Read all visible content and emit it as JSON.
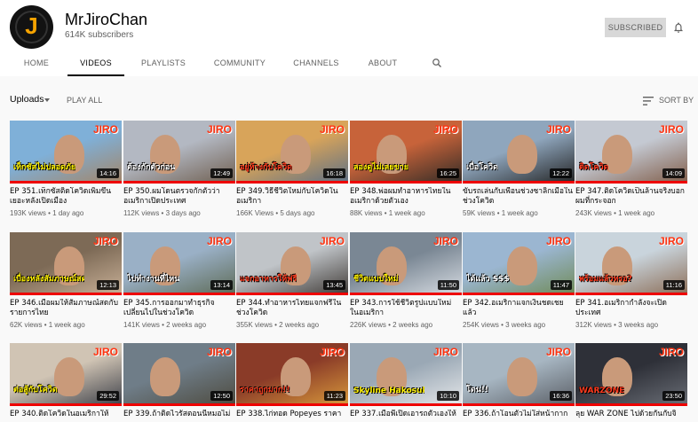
{
  "channel": {
    "avatar_letter": "J",
    "name": "MrJiroChan",
    "subscribers": "614K subscribers",
    "subscribe_label": "SUBSCRIBED"
  },
  "tabs": [
    "HOME",
    "VIDEOS",
    "PLAYLISTS",
    "COMMUNITY",
    "CHANNELS",
    "ABOUT"
  ],
  "active_tab": "VIDEOS",
  "toolbar": {
    "uploads_label": "Uploads",
    "play_all_label": "PLAY ALL",
    "sort_label": "SORT BY"
  },
  "colors": {
    "accent_red": "#ff0000",
    "logo_red": "#ff3311"
  },
  "videos": [
    {
      "title": "EP 351.เท็กซัสติดโควิดเพิ่มขึ้นเยอะหลังเปิดเมือง",
      "views": "193K views",
      "age": "1 day ago",
      "duration": "14:16",
      "thumb_text": "เท็กซัสไม่ปลอดภัย"
    },
    {
      "title": "EP 350.ผมโดนตรวจกักตัวว่าอเมริกาเปิดประเทศ",
      "views": "112K views",
      "age": "3 days ago",
      "duration": "12:49",
      "thumb_text": "ต้องกักตัวก่อน"
    },
    {
      "title": "EP 349.วิธีชีวิตใหม่กับโควิดในอเมริกา",
      "views": "166K Views",
      "age": "5 days ago",
      "duration": "16:18",
      "thumb_text": "อยู่ห้างกับโควิด"
    },
    {
      "title": "EP 348.พ่อผมทำอาหารไทยในอเมริกาด้วยตัวเอง",
      "views": "88K views",
      "age": "1 week ago",
      "duration": "16:25",
      "thumb_text": "ลองดูไม่เลยขาย"
    },
    {
      "title": "ขับรถเล่นกับเพื่อนช่วงซาลิกเมื่อในช่วงโควิด",
      "views": "59K views",
      "age": "1 week ago",
      "duration": "12:22",
      "thumb_text": "เบื่อโควิด"
    },
    {
      "title": "EP 347.ติดโควิดเป็นล้านจริงบอกผมที่กระจอก",
      "views": "243K views",
      "age": "1 week ago",
      "duration": "14:09",
      "thumb_text": "ติดโควิด"
    },
    {
      "title": "EP 346.เมื่อผมให้สัมภาษณ์สดกับรายการไทย",
      "views": "62K views",
      "age": "1 week ago",
      "duration": "12:13",
      "thumb_text": "เบื่องหลังสัมภาษณ์สด"
    },
    {
      "title": "EP 345.การออกมาทำธุรกิจเปลี่ยนไปในช่วงโควิด",
      "views": "141K views",
      "age": "2 weeks ago",
      "duration": "13:14",
      "thumb_text": "ไปทำงานที่ไหน"
    },
    {
      "title": "EP 344.ทำอาหารไทยแจกฟรีในช่วงโควิด",
      "views": "355K views",
      "age": "2 weeks ago",
      "duration": "13:45",
      "thumb_text": "แจกอาหารให้ฟรี"
    },
    {
      "title": "EP 343.การใช้ชีวิตรูปแบบใหม่ในอเมริกา",
      "views": "226K views",
      "age": "2 weeks ago",
      "duration": "11:50",
      "thumb_text": "ชีวิตแบบใหม่"
    },
    {
      "title": "EP 342.อเมริกาแจกเงินชดเชยแล้ว",
      "views": "254K views",
      "age": "3 weeks ago",
      "duration": "11:47",
      "thumb_text": "ได้แล้ว $$$"
    },
    {
      "title": "EP 341.อเมริกากำลังจะเปิดประเทศ",
      "views": "312K views",
      "age": "3 weeks ago",
      "duration": "11:16",
      "thumb_text": "พร้อมแล้วหรอ?"
    },
    {
      "title": "EP 340.ติดโควิดในอเมริกาให้",
      "views": "",
      "age": "",
      "duration": "29:52",
      "thumb_text": "ต่อสู้กับโควิด"
    },
    {
      "title": "EP 339.ถ้าติดไวรัสตอนนี้หมอไม่",
      "views": "",
      "age": "",
      "duration": "12:50",
      "thumb_text": ""
    },
    {
      "title": "EP 338.ไก่ทอด Popeyes ราคา",
      "views": "",
      "age": "",
      "duration": "11:23",
      "thumb_text": "ราคาถูกมาก!!"
    },
    {
      "title": "EP 337.เมื่อพี่เปิดเอารถตัวเองให้",
      "views": "",
      "age": "",
      "duration": "10:10",
      "thumb_text": "Skyline Hakosuka C10"
    },
    {
      "title": "EP 336.ถ้าโอนตัวไม่ใส่หน้ากาก",
      "views": "",
      "age": "",
      "duration": "16:36",
      "thumb_text": "โดน!!"
    },
    {
      "title": "ลุย WAR ZONE ไปด้วยกันกับจิ",
      "views": "",
      "age": "",
      "duration": "23:50",
      "thumb_text": "WARZONE"
    }
  ]
}
